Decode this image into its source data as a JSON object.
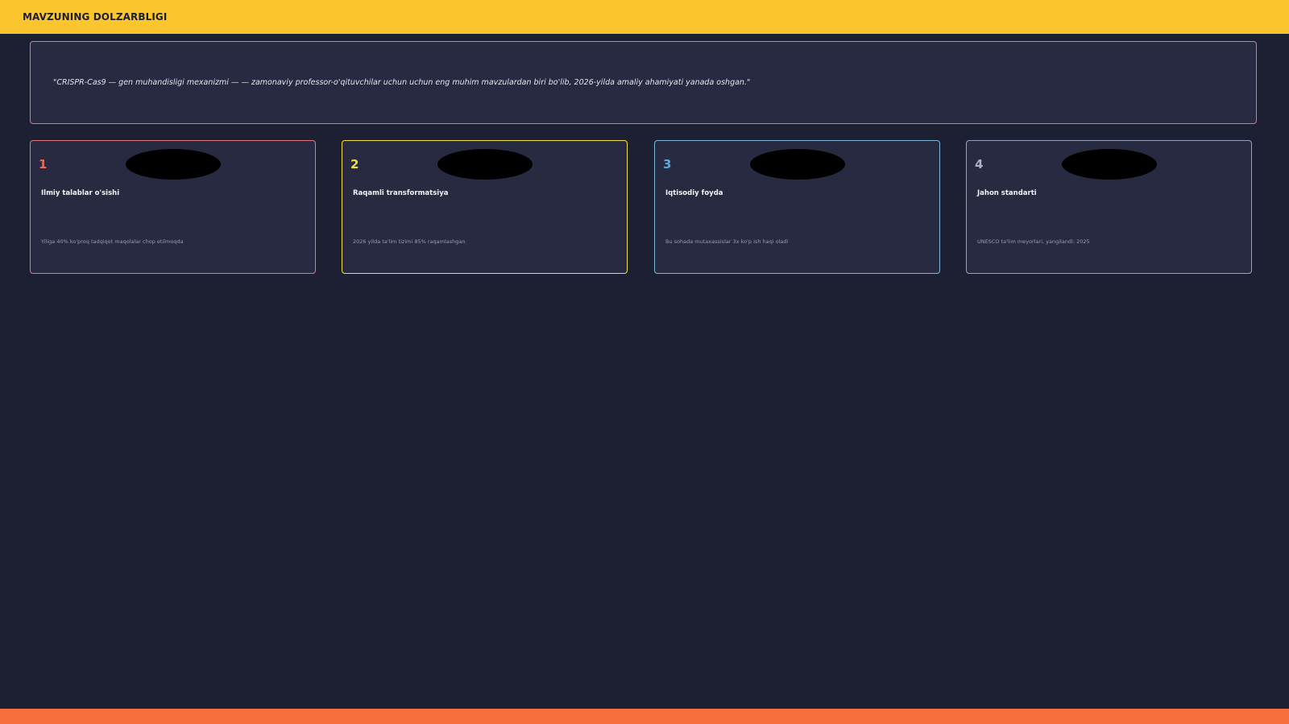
{
  "header": {
    "title": "MAVZUNING DOLZARBLIGI"
  },
  "quote": {
    "text": "\"CRISPR-Cas9 — gen muhandisligi mexanizmi — — zamonaviy professor-o'qituvchilar uchun uchun eng muhim mavzulardan biri bo'lib, 2026-yilda amaliy ahamiyati yanada oshgan.\""
  },
  "cards": [
    {
      "number": "1",
      "title": "Ilmiy talablar o'sishi",
      "description": "Yiliga 40% ko'proq tadqiqot maqolalar chop etilmoqda",
      "accent": "#e07a7a"
    },
    {
      "number": "2",
      "title": "Raqamli transformatsiya",
      "description": "2026 yilda ta'lim tizimi 85% raqamlashgan",
      "accent": "#f2e03a"
    },
    {
      "number": "3",
      "title": "Iqtisodiy foyda",
      "description": "Bu sohada mutaxassislar 3x ko'p ish haqi oladi",
      "accent": "#7fb7d8"
    },
    {
      "number": "4",
      "title": "Jahon standarti",
      "description": "UNESCO ta'lim meyorlari, yangilandi: 2025",
      "accent": "#9aa3bd"
    }
  ],
  "colors": {
    "background": "#1d2033",
    "header_bar": "#fbc52e",
    "footer_bar": "#f66e3c"
  }
}
